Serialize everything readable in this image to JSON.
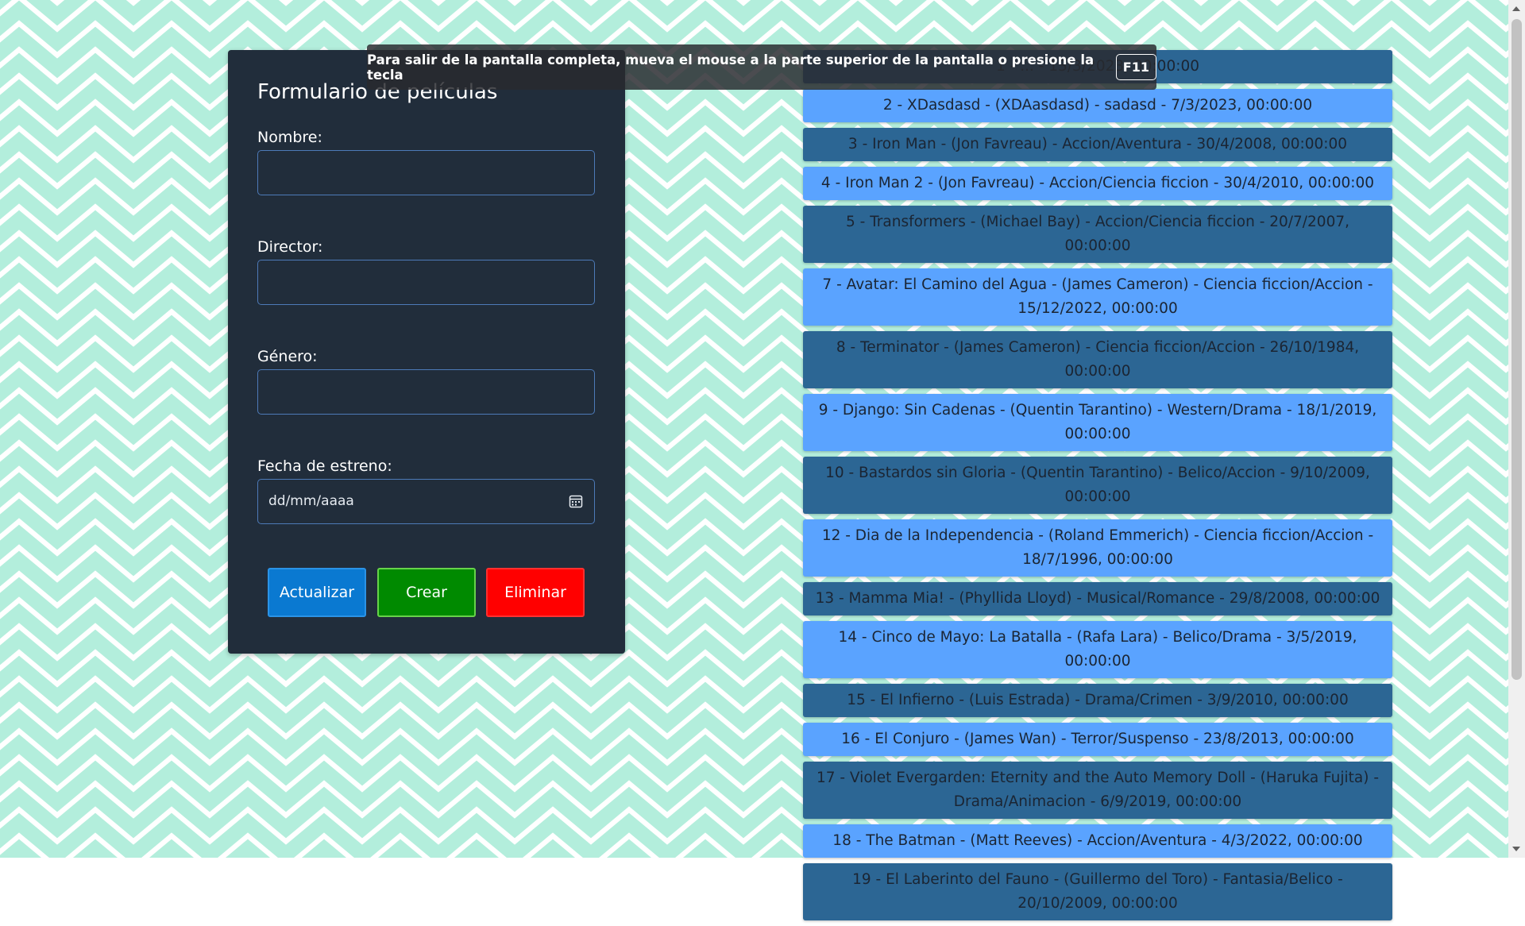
{
  "toast": {
    "message": "Para salir de la pantalla completa, mueva el mouse a la parte superior de la pantalla o presione la tecla",
    "key": "F11"
  },
  "form": {
    "title": "Formulario de películas",
    "fields": {
      "nombre": {
        "label": "Nombre:",
        "value": ""
      },
      "director": {
        "label": "Director:",
        "value": ""
      },
      "genero": {
        "label": "Género:",
        "value": ""
      },
      "fecha": {
        "label": "Fecha de estreno:",
        "placeholder": "dd/mm/aaaa"
      }
    },
    "buttons": {
      "update": "Actualizar",
      "create": "Crear",
      "delete": "Eliminar"
    }
  },
  "movies": [
    {
      "text": "1 - ... - 13/3/2023, 00:00:00",
      "shade": "dark"
    },
    {
      "text": "2 - XDasdasd - (XDAasdasd) - sadasd - 7/3/2023, 00:00:00",
      "shade": "light"
    },
    {
      "text": "3 - Iron Man - (Jon Favreau) - Accion/Aventura - 30/4/2008, 00:00:00",
      "shade": "dark"
    },
    {
      "text": "4 - Iron Man 2 - (Jon Favreau) - Accion/Ciencia ficcion - 30/4/2010, 00:00:00",
      "shade": "light"
    },
    {
      "text": "5 - Transformers - (Michael Bay) - Accion/Ciencia ficcion - 20/7/2007, 00:00:00",
      "shade": "dark"
    },
    {
      "text": "7 - Avatar: El Camino del Agua - (James Cameron) - Ciencia ficcion/Accion - 15/12/2022, 00:00:00",
      "shade": "light"
    },
    {
      "text": "8 - Terminator - (James Cameron) - Ciencia ficcion/Accion - 26/10/1984, 00:00:00",
      "shade": "dark"
    },
    {
      "text": "9 - Django: Sin Cadenas - (Quentin Tarantino) - Western/Drama - 18/1/2019, 00:00:00",
      "shade": "light"
    },
    {
      "text": "10 - Bastardos sin Gloria - (Quentin Tarantino) - Belico/Accion - 9/10/2009, 00:00:00",
      "shade": "dark"
    },
    {
      "text": "12 - Dia de la Independencia - (Roland Emmerich) - Ciencia ficcion/Accion - 18/7/1996, 00:00:00",
      "shade": "light"
    },
    {
      "text": "13 - Mamma Mia! - (Phyllida Lloyd) - Musical/Romance - 29/8/2008, 00:00:00",
      "shade": "dark"
    },
    {
      "text": "14 - Cinco de Mayo: La Batalla - (Rafa Lara) - Belico/Drama - 3/5/2019, 00:00:00",
      "shade": "light"
    },
    {
      "text": "15 - El Infierno - (Luis Estrada) - Drama/Crimen - 3/9/2010, 00:00:00",
      "shade": "dark"
    },
    {
      "text": "16 - El Conjuro - (James Wan) - Terror/Suspenso - 23/8/2013, 00:00:00",
      "shade": "light"
    },
    {
      "text": "17 - Violet Evergarden: Eternity and the Auto Memory Doll - (Haruka Fujita) - Drama/Animacion - 6/9/2019, 00:00:00",
      "shade": "dark"
    },
    {
      "text": "18 - The Batman - (Matt Reeves) - Accion/Aventura - 4/3/2022, 00:00:00",
      "shade": "light"
    },
    {
      "text": "19 - El Laberinto del Fauno - (Guillermo del Toro) - Fantasia/Belico - 20/10/2009, 00:00:00",
      "shade": "dark"
    }
  ],
  "colors": {
    "background_chevron": "#b3eedc",
    "form_card": "#212d3b",
    "item_dark": "#2c6694",
    "item_light": "#5aa3ff",
    "btn_update": "#0a79d1",
    "btn_create": "#008a00",
    "btn_delete": "#ff0000"
  },
  "icons": {
    "date_picker": "calendar-icon"
  }
}
